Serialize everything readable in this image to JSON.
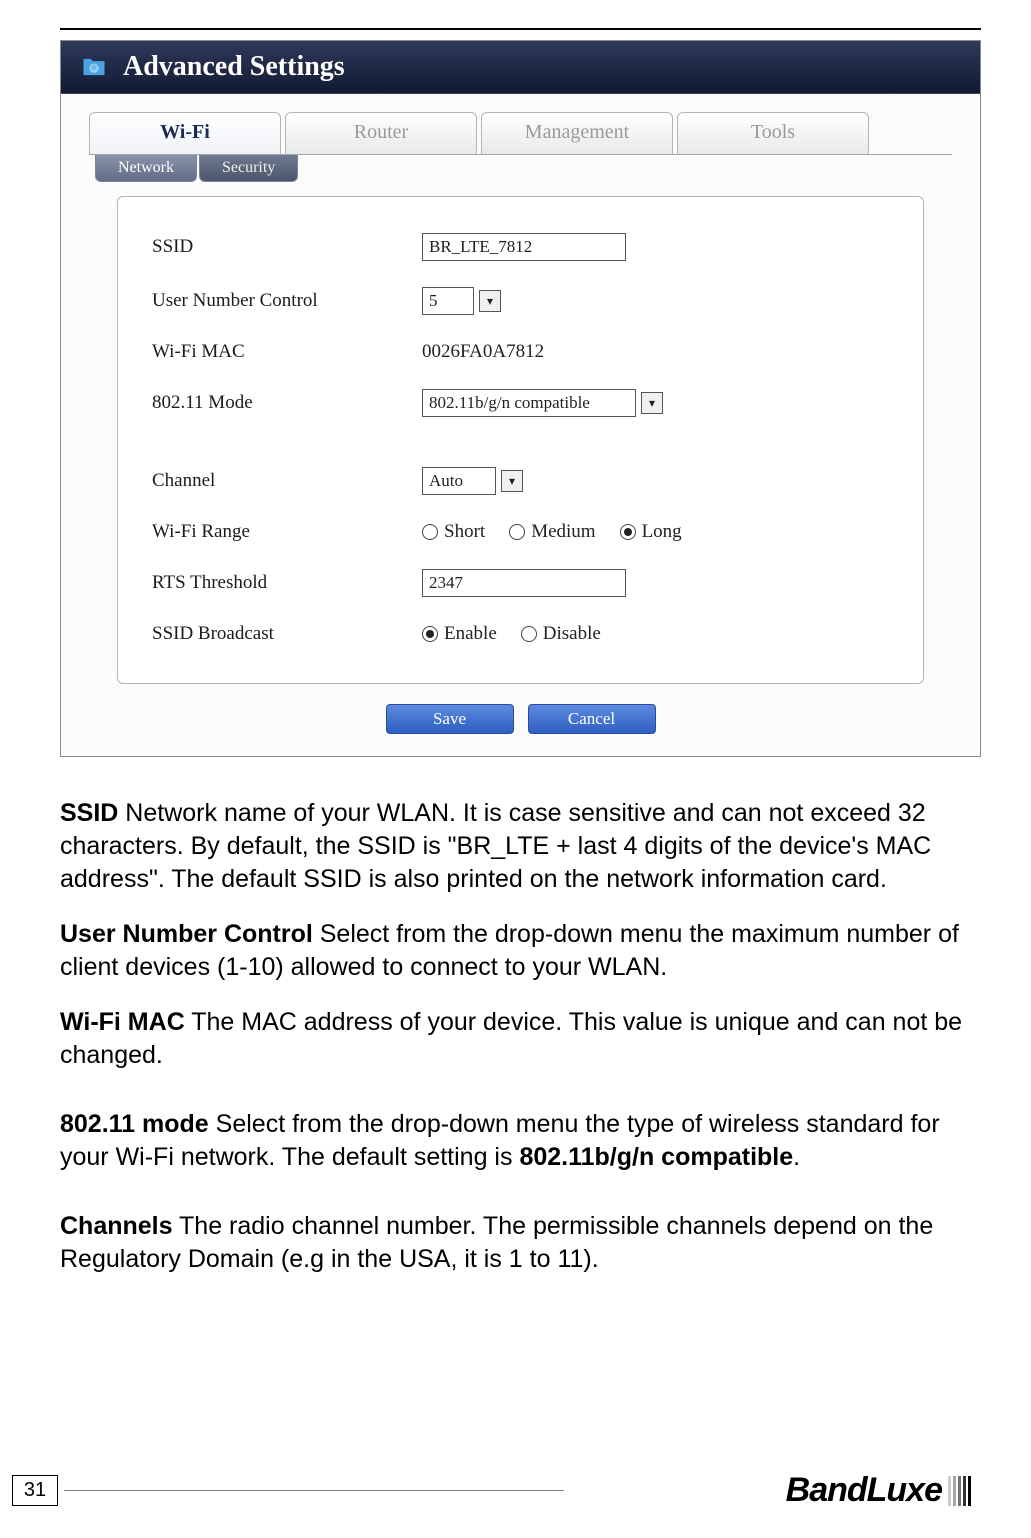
{
  "titlebar": {
    "title": "Advanced Settings"
  },
  "tabs_main": [
    {
      "label": "Wi-Fi",
      "active": true
    },
    {
      "label": "Router",
      "active": false
    },
    {
      "label": "Management",
      "active": false
    },
    {
      "label": "Tools",
      "active": false
    }
  ],
  "tabs_sub": [
    {
      "label": "Network",
      "active": true
    },
    {
      "label": "Security",
      "active": false
    }
  ],
  "form": {
    "ssid": {
      "label": "SSID",
      "value": "BR_LTE_7812"
    },
    "user_number_control": {
      "label": "User Number Control",
      "value": "5"
    },
    "wifi_mac": {
      "label": "Wi-Fi MAC",
      "value": "0026FA0A7812"
    },
    "mode_80211": {
      "label": "802.11 Mode",
      "value": "802.11b/g/n compatible"
    },
    "channel": {
      "label": "Channel",
      "value": "Auto"
    },
    "wifi_range": {
      "label": "Wi-Fi Range",
      "options": [
        "Short",
        "Medium",
        "Long"
      ],
      "selected": "Long"
    },
    "rts_threshold": {
      "label": "RTS Threshold",
      "value": "2347"
    },
    "ssid_broadcast": {
      "label": "SSID Broadcast",
      "options": [
        "Enable",
        "Disable"
      ],
      "selected": "Enable"
    }
  },
  "buttons": {
    "save": "Save",
    "cancel": "Cancel"
  },
  "body": {
    "ssid_bold": "SSID",
    "ssid_text": " Network name of your WLAN. It is case sensitive and can not exceed 32 characters. By default, the SSID is \"BR_LTE + last 4 digits of the device's MAC address\". The default SSID is also printed on the network information card.",
    "unc_bold": "User Number Control",
    "unc_text": " Select from the drop-down menu the maximum number of client devices (1-10) allowed to connect to your WLAN.",
    "mac_bold": "Wi-Fi MAC",
    "mac_text": " The MAC address of your device. This value is unique and can not be changed.",
    "mode_bold": "802.11 mode",
    "mode_text1": " Select from the drop-down menu the type of wireless standard for your Wi-Fi network. The default setting is ",
    "mode_text2": "802.11b/g/n compatible",
    "mode_text3": ".",
    "channels_bold": "Channels",
    "channels_text": " The radio channel number. The permissible channels depend on the Regulatory Domain (e.g in the USA, it is 1 to 11)."
  },
  "footer": {
    "page_number": "31",
    "brand": "BandLuxe"
  }
}
